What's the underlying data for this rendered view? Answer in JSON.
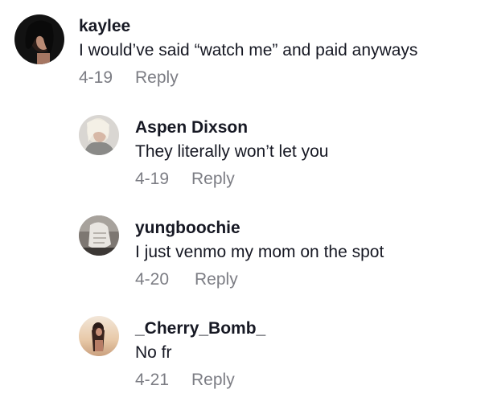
{
  "comments": [
    {
      "username": "kaylee",
      "text": "I would’ve said “watch me” and paid anyways",
      "date": "4-19",
      "reply_label": "Reply"
    },
    {
      "username": "Aspen Dixson",
      "text": "They literally won’t let you",
      "date": "4-19",
      "reply_label": "Reply"
    },
    {
      "username": "yungboochie",
      "text": "I just venmo my mom on the spot",
      "date": "4-20",
      "reply_label": "Reply"
    },
    {
      "username": "_Cherry_Bomb_",
      "text": "No fr",
      "date": "4-21",
      "reply_label": "Reply"
    }
  ],
  "colors": {
    "text_primary": "#161823",
    "text_secondary": "#7c7d84",
    "background": "#ffffff"
  }
}
